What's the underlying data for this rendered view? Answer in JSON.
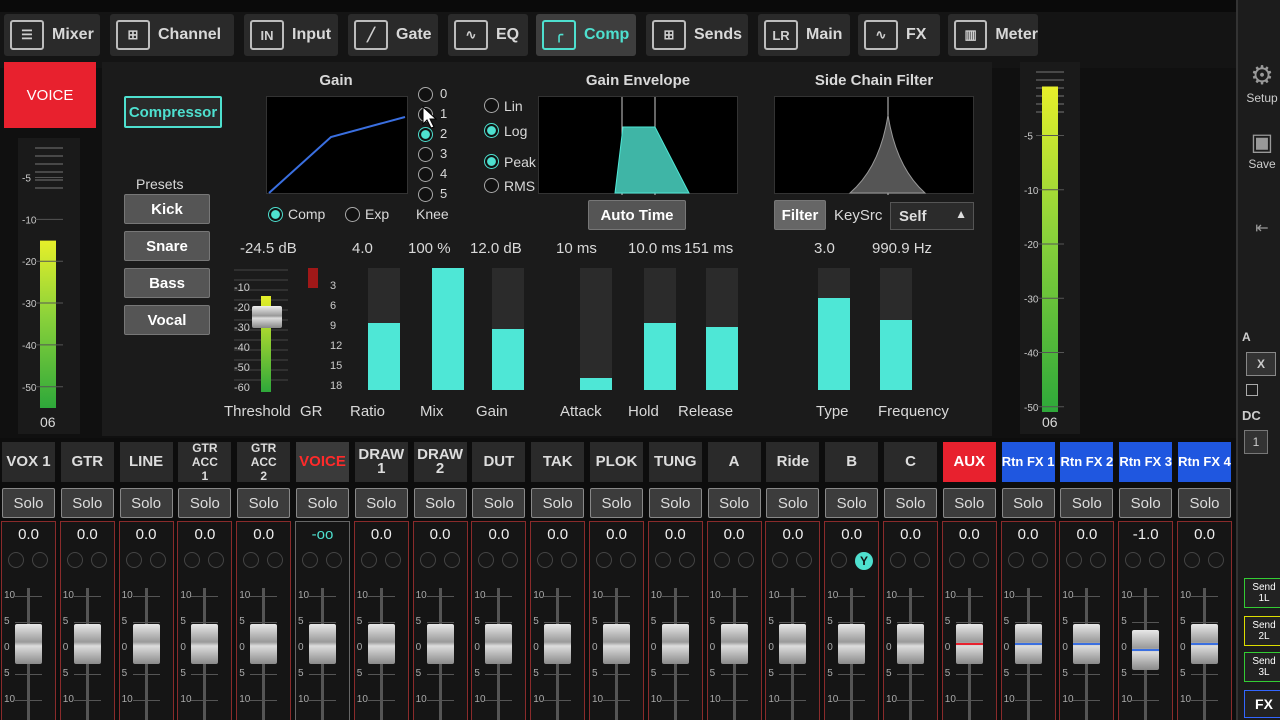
{
  "tabs": [
    {
      "label": "Mixer",
      "icon": "mixer-icon",
      "glyph": "☰"
    },
    {
      "label": "Channel",
      "icon": "channel-icon",
      "glyph": "⊞"
    },
    {
      "label": "Input",
      "icon": "input-icon",
      "glyph": "IN"
    },
    {
      "label": "Gate",
      "icon": "gate-icon",
      "glyph": "╱"
    },
    {
      "label": "EQ",
      "icon": "eq-icon",
      "glyph": "∿"
    },
    {
      "label": "Comp",
      "icon": "comp-icon",
      "glyph": "╭"
    },
    {
      "label": "Sends",
      "icon": "sends-icon",
      "glyph": "⊞"
    },
    {
      "label": "Main",
      "icon": "main-icon",
      "glyph": "LR"
    },
    {
      "label": "FX",
      "icon": "fx-icon",
      "glyph": "∿"
    },
    {
      "label": "Meter",
      "icon": "meter-icon",
      "glyph": "▥"
    }
  ],
  "active_tab": "Comp",
  "side": {
    "setup": "Setup",
    "save": "Save",
    "dc": "DC",
    "one": "1",
    "x": "X",
    "a": "A",
    "sends": [
      "Send\n1L",
      "Send\n2L",
      "Send\n3L"
    ],
    "fx": "FX"
  },
  "channel_name": "VOICE",
  "left_meter_label": "06",
  "right_meter_label": "06",
  "left_meter_scale": [
    "-5",
    "-10",
    "-20",
    "-30",
    "-40",
    "-50"
  ],
  "right_meter_scale": [
    "-5",
    "-10",
    "-20",
    "-30",
    "-40",
    "-50"
  ],
  "left_meter_level": 0.62,
  "right_meter_level": 0.93,
  "compressor_button": "Compressor",
  "presets": {
    "title": "Presets",
    "items": [
      "Kick",
      "Snare",
      "Bass",
      "Vocal"
    ]
  },
  "gain_section": {
    "title": "Gain",
    "mode_comp": "Comp",
    "mode_exp": "Exp",
    "knee_label": "Knee",
    "knee_options": [
      "0",
      "1",
      "2",
      "3",
      "4",
      "5"
    ],
    "knee_selected": "2"
  },
  "envelope": {
    "title": "Gain Envelope",
    "lin": "Lin",
    "log": "Log",
    "peak": "Peak",
    "rms": "RMS",
    "auto_time": "Auto Time"
  },
  "sidechain": {
    "title": "Side Chain Filter",
    "filter": "Filter",
    "keysrc_label": "KeySrc",
    "keysrc_value": "Self"
  },
  "threshold": {
    "value": "-24.5 dB",
    "label": "Threshold",
    "scale": [
      "-10",
      "-20",
      "-30",
      "-40",
      "-50",
      "-60"
    ]
  },
  "gr": {
    "label": "GR",
    "scale": [
      "3",
      "6",
      "9",
      "12",
      "15",
      "18"
    ]
  },
  "faders": [
    {
      "label": "Ratio",
      "value": "4.0",
      "level": 0.55
    },
    {
      "label": "Mix",
      "value": "100 %",
      "level": 1.0
    },
    {
      "label": "Gain",
      "value": "12.0 dB",
      "level": 0.5
    },
    {
      "label": "Attack",
      "value": "10 ms",
      "level": 0.1
    },
    {
      "label": "Hold",
      "value": "10.0 ms",
      "level": 0.55
    },
    {
      "label": "Release",
      "value": "151 ms",
      "level": 0.52
    },
    {
      "label": "Type",
      "value": "3.0",
      "level": 0.75
    },
    {
      "label": "Frequency",
      "value": "990.9 Hz",
      "level": 0.57
    }
  ],
  "channels": [
    {
      "name": "VOX 1",
      "solo": "Solo",
      "value": "0.0",
      "style": "normal"
    },
    {
      "name": "GTR",
      "solo": "Solo",
      "value": "0.0",
      "style": "normal"
    },
    {
      "name": "LINE",
      "solo": "Solo",
      "value": "0.0",
      "style": "normal"
    },
    {
      "name": "GTR ACC\n1",
      "solo": "Solo",
      "value": "0.0",
      "style": "small"
    },
    {
      "name": "GTR ACC\n2",
      "solo": "Solo",
      "value": "0.0",
      "style": "small"
    },
    {
      "name": "VOICE",
      "solo": "Solo",
      "value": "-oo",
      "style": "voice"
    },
    {
      "name": "DRAW 1",
      "solo": "Solo",
      "value": "0.0",
      "style": "normal"
    },
    {
      "name": "DRAW 2",
      "solo": "Solo",
      "value": "0.0",
      "style": "normal"
    },
    {
      "name": "DUT",
      "solo": "Solo",
      "value": "0.0",
      "style": "normal"
    },
    {
      "name": "TAK",
      "solo": "Solo",
      "value": "0.0",
      "style": "normal"
    },
    {
      "name": "PLOK",
      "solo": "Solo",
      "value": "0.0",
      "style": "normal"
    },
    {
      "name": "TUNG",
      "solo": "Solo",
      "value": "0.0",
      "style": "normal"
    },
    {
      "name": "A",
      "solo": "Solo",
      "value": "0.0",
      "style": "normal"
    },
    {
      "name": "Ride",
      "solo": "Solo",
      "value": "0.0",
      "style": "normal"
    },
    {
      "name": "B",
      "solo": "Solo",
      "value": "0.0",
      "style": "normal"
    },
    {
      "name": "C",
      "solo": "Solo",
      "value": "0.0",
      "style": "normal"
    },
    {
      "name": "AUX",
      "solo": "Solo",
      "value": "0.0",
      "style": "red"
    },
    {
      "name": "Rtn FX 1",
      "solo": "Solo",
      "value": "0.0",
      "style": "blue"
    },
    {
      "name": "Rtn FX 2",
      "solo": "Solo",
      "value": "0.0",
      "style": "blue"
    },
    {
      "name": "Rtn FX 3",
      "solo": "Solo",
      "value": "-1.0",
      "style": "blue"
    },
    {
      "name": "Rtn FX 4",
      "solo": "Solo",
      "value": "0.0",
      "style": "blue"
    }
  ],
  "fader_scale": [
    "10",
    "5",
    "0",
    "5",
    "10"
  ],
  "y_badge": "Y"
}
